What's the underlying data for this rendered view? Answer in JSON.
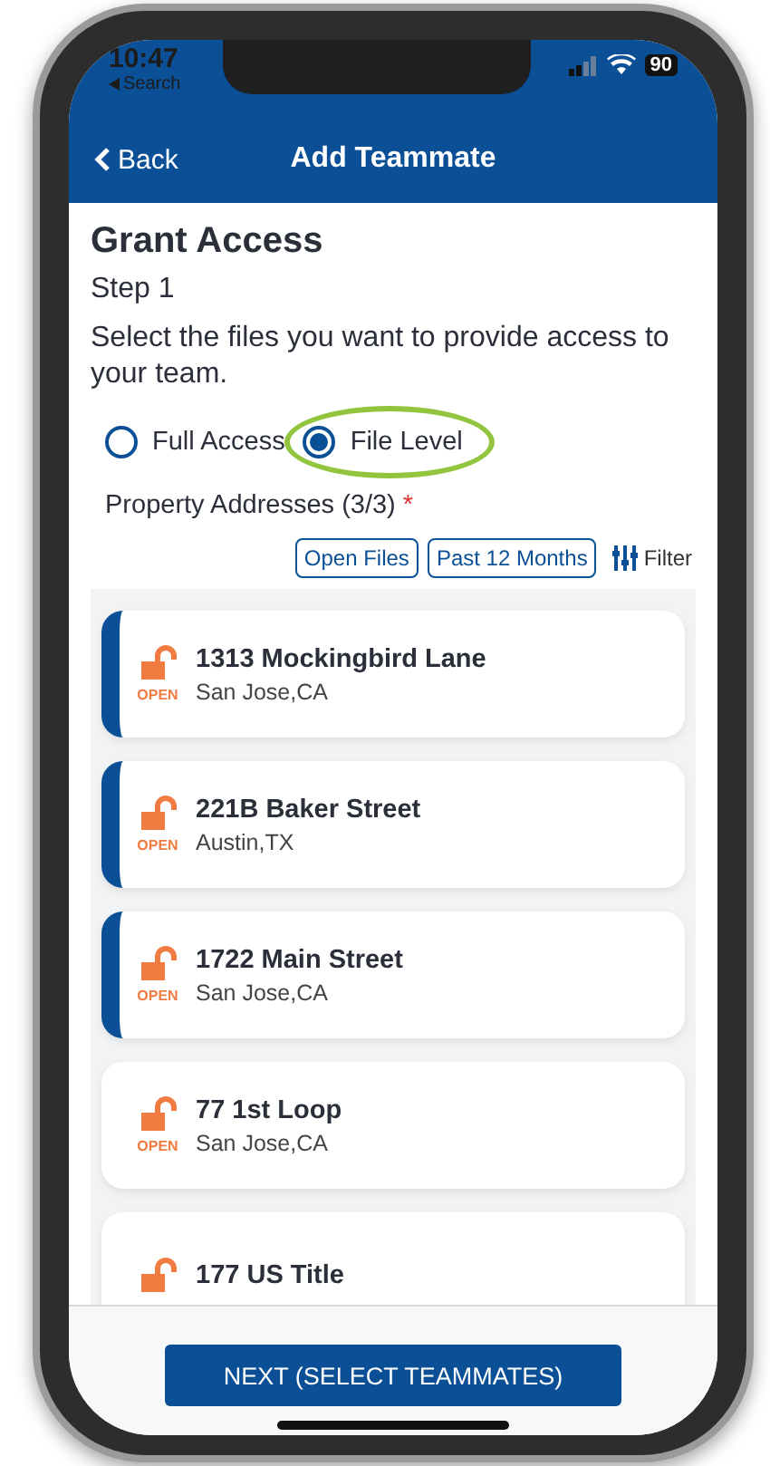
{
  "status_bar": {
    "time": "10:47",
    "back_app": "Search",
    "battery": "90"
  },
  "nav": {
    "back": "Back",
    "title": "Add Teammate"
  },
  "heading": "Grant Access",
  "step": "Step 1",
  "instruction": "Select the files you want to provide access to your team.",
  "access_options": [
    {
      "label": "Full Access",
      "selected": false
    },
    {
      "label": "File Level",
      "selected": true,
      "highlighted": true
    }
  ],
  "section": {
    "label": "Property Addresses (3/3)",
    "required": "*"
  },
  "filters": [
    {
      "label": "Open Files"
    },
    {
      "label": "Past 12 Months"
    }
  ],
  "filter_button": "Filter",
  "addresses": [
    {
      "street": "1313 Mockingbird Lane",
      "city": "San Jose,CA",
      "status": "OPEN",
      "selected": true
    },
    {
      "street": "221B Baker Street",
      "city": "Austin,TX",
      "status": "OPEN",
      "selected": true
    },
    {
      "street": "1722 Main Street",
      "city": "San Jose,CA",
      "status": "OPEN",
      "selected": true
    },
    {
      "street": "77 1st Loop",
      "city": "San Jose,CA",
      "status": "OPEN",
      "selected": false
    },
    {
      "street": "177 US Title",
      "selected": false
    }
  ],
  "next_button": "NEXT (SELECT TEAMMATES)"
}
